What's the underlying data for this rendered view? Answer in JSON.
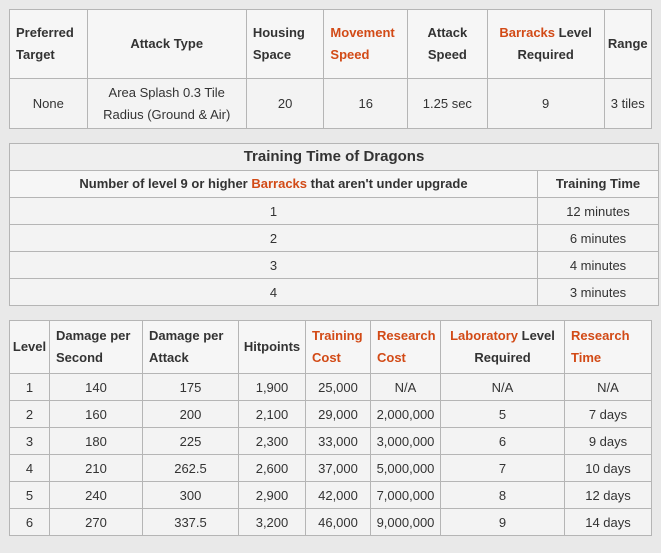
{
  "stats": {
    "headers": {
      "preferred_target": "Preferred Target",
      "attack_type": "Attack Type",
      "housing_space": "Housing Space",
      "movement_speed": "Movement Speed",
      "attack_speed": "Attack Speed",
      "barracks_word": "Barracks",
      "level_required": "Level Required",
      "range": "Range"
    },
    "row": {
      "preferred_target": "None",
      "attack_type": "Area Splash 0.3 Tile Radius (Ground & Air)",
      "housing_space": "20",
      "movement_speed": "16",
      "attack_speed": "1.25 sec",
      "barracks_level": "9",
      "range": "3 tiles"
    }
  },
  "training": {
    "title": "Training Time of Dragons",
    "col1_pre": "Number of level 9 or higher ",
    "col1_link": "Barracks",
    "col1_post": " that aren't under upgrade",
    "col2": "Training Time",
    "rows": [
      {
        "count": "1",
        "time": "12 minutes"
      },
      {
        "count": "2",
        "time": "6 minutes"
      },
      {
        "count": "3",
        "time": "4 minutes"
      },
      {
        "count": "4",
        "time": "3 minutes"
      }
    ]
  },
  "levels": {
    "headers": {
      "level": "Level",
      "dps": "Damage per Second",
      "dpa": "Damage per Attack",
      "hitpoints": "Hitpoints",
      "training_cost": "Training Cost",
      "research_cost": "Research Cost",
      "laboratory_word": "Laboratory",
      "level_required": "Level Required",
      "research_time": "Research Time"
    },
    "rows": [
      {
        "level": "1",
        "dps": "140",
        "dpa": "175",
        "hp": "1,900",
        "train": "25,000",
        "rcost": "N/A",
        "lab": "N/A",
        "rtime": "N/A"
      },
      {
        "level": "2",
        "dps": "160",
        "dpa": "200",
        "hp": "2,100",
        "train": "29,000",
        "rcost": "2,000,000",
        "lab": "5",
        "rtime": "7 days"
      },
      {
        "level": "3",
        "dps": "180",
        "dpa": "225",
        "hp": "2,300",
        "train": "33,000",
        "rcost": "3,000,000",
        "lab": "6",
        "rtime": "9 days"
      },
      {
        "level": "4",
        "dps": "210",
        "dpa": "262.5",
        "hp": "2,600",
        "train": "37,000",
        "rcost": "5,000,000",
        "lab": "7",
        "rtime": "10 days"
      },
      {
        "level": "5",
        "dps": "240",
        "dpa": "300",
        "hp": "2,900",
        "train": "42,000",
        "rcost": "7,000,000",
        "lab": "8",
        "rtime": "12 days"
      },
      {
        "level": "6",
        "dps": "270",
        "dpa": "337.5",
        "hp": "3,200",
        "train": "46,000",
        "rcost": "9,000,000",
        "lab": "9",
        "rtime": "14 days"
      }
    ]
  },
  "colors": {
    "link": "#d24a16",
    "border": "#b5b5b5",
    "cell_bg": "#f3f3f3",
    "page_bg": "#e9e9e9"
  }
}
